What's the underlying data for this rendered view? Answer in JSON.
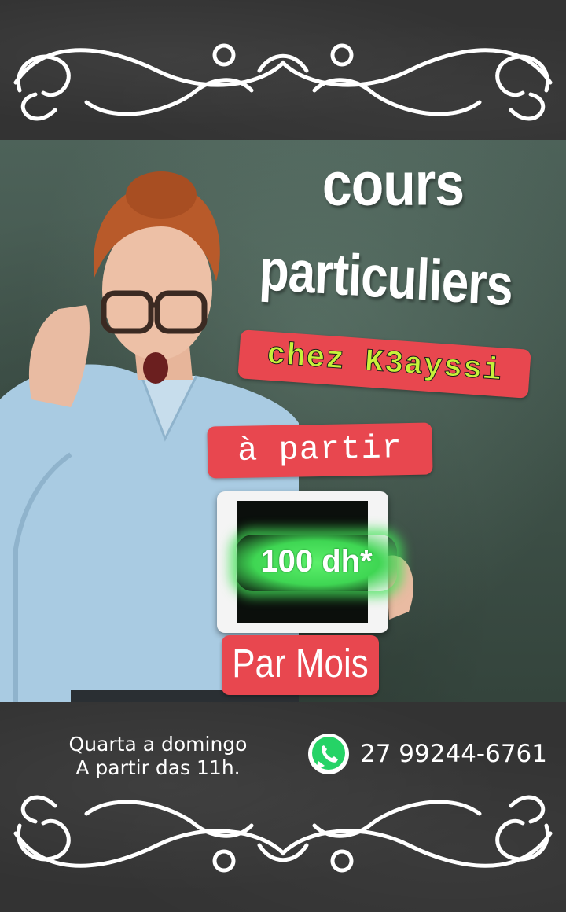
{
  "poster": {
    "headline_line1": "cours",
    "headline_line2": "particuliers",
    "tagline": "chez K3ayssi",
    "from_label": "à partir",
    "price": "100 dh*",
    "period": "Par Mois",
    "schedule_line1": "Quarta a domingo",
    "schedule_line2": "A partir das 11h.",
    "phone": "27 99244-6761"
  },
  "icons": {
    "contact": "whatsapp-icon",
    "ornament": "flourish-ornament"
  },
  "colors": {
    "pill_red": "#e8474f",
    "tagline_green": "#c6f23a",
    "price_green": "#3fd653",
    "chalkboard": "#3f5249",
    "dark_band": "#333333",
    "whatsapp": "#25d366"
  }
}
